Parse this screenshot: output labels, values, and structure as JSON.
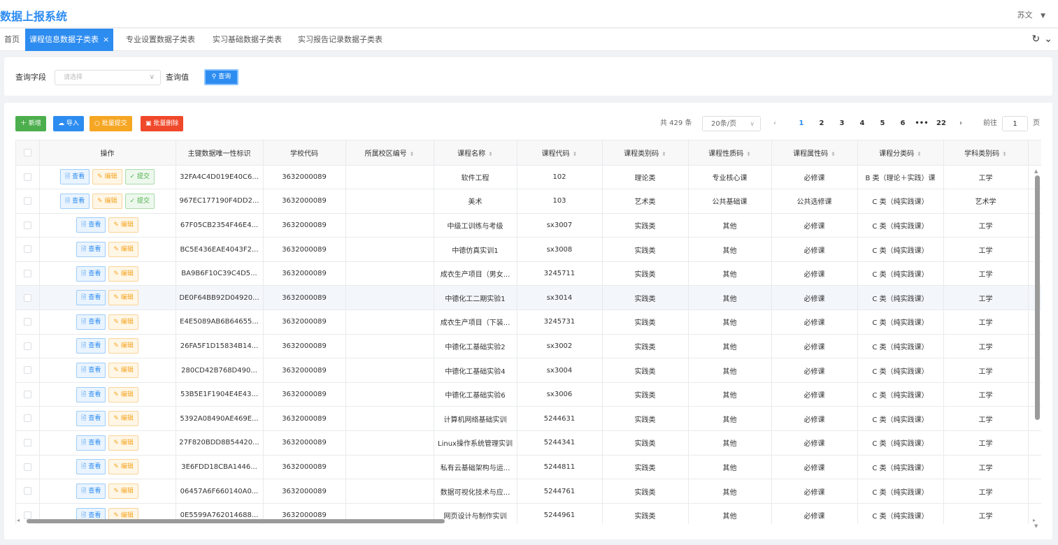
{
  "app": {
    "title": "数据上报系统",
    "user": "苏文"
  },
  "tabs": [
    {
      "label": "首页"
    },
    {
      "label": "课程信息数据子类表",
      "close": "×"
    },
    {
      "label": "专业设置数据子类表"
    },
    {
      "label": "实习基础数据子类表"
    },
    {
      "label": "实习报告记录数据子类表"
    }
  ],
  "query": {
    "field_label": "查询字段",
    "field_placeholder": "请选择",
    "value_label": "查询值",
    "search_button": "查询"
  },
  "toolbar": {
    "add": "新增",
    "import": "导入",
    "batch_submit": "批量提交",
    "batch_delete": "批量删除"
  },
  "pager": {
    "total": "共 429 条",
    "page_size": "20条/页",
    "pages": [
      "1",
      "2",
      "3",
      "4",
      "5",
      "6",
      "•••",
      "22"
    ],
    "current": "1",
    "goto_label": "前往",
    "goto_value": "1",
    "goto_suffix": "页"
  },
  "table": {
    "headers": [
      "操作",
      "主键数据唯一性标识",
      "学校代码",
      "所属校区编号",
      "课程名称",
      "课程代码",
      "课程类别码",
      "课程性质码",
      "课程属性码",
      "课程分类码",
      "学科类别码"
    ],
    "action_labels": {
      "view": "查看",
      "edit": "编辑",
      "submit": "提交"
    },
    "rows": [
      {
        "id": "32FA4C4D019E40C6...",
        "school": "3632000089",
        "campus": "",
        "name": "软件工程",
        "code": "102",
        "category": "理论类",
        "nature": "专业核心课",
        "attr": "必修课",
        "cls": "B 类（理论＋实践）课",
        "subject": "工学",
        "submit": true
      },
      {
        "id": "967EC177190F4DD2...",
        "school": "3632000089",
        "campus": "",
        "name": "美术",
        "code": "103",
        "category": "艺术类",
        "nature": "公共基础课",
        "attr": "公共选修课",
        "cls": "C 类（纯实践课）",
        "subject": "艺术学",
        "submit": true
      },
      {
        "id": "67F05CB2354F46E4...",
        "school": "3632000089",
        "campus": "",
        "name": "中级工训练与考级",
        "code": "sx3007",
        "category": "实践类",
        "nature": "其他",
        "attr": "必修课",
        "cls": "C 类（纯实践课）",
        "subject": "工学",
        "submit": false
      },
      {
        "id": "BC5E436EAE4043F2...",
        "school": "3632000089",
        "campus": "",
        "name": "中德仿真实训1",
        "code": "sx3008",
        "category": "实践类",
        "nature": "其他",
        "attr": "必修课",
        "cls": "C 类（纯实践课）",
        "subject": "工学",
        "submit": false
      },
      {
        "id": "BA9B6F10C39C4D5...",
        "school": "3632000089",
        "campus": "",
        "name": "成衣生产项目（男女...",
        "code": "3245711",
        "category": "实践类",
        "nature": "其他",
        "attr": "必修课",
        "cls": "C 类（纯实践课）",
        "subject": "工学",
        "submit": false
      },
      {
        "id": "DE0F64BB92D04920...",
        "school": "3632000089",
        "campus": "",
        "name": "中德化工二期实验1",
        "code": "sx3014",
        "category": "实践类",
        "nature": "其他",
        "attr": "必修课",
        "cls": "C 类（纯实践课）",
        "subject": "工学",
        "submit": false
      },
      {
        "id": "E4E5089AB6B64655...",
        "school": "3632000089",
        "campus": "",
        "name": "成衣生产项目（下装...",
        "code": "3245731",
        "category": "实践类",
        "nature": "其他",
        "attr": "必修课",
        "cls": "C 类（纯实践课）",
        "subject": "工学",
        "submit": false
      },
      {
        "id": "26FA5F1D15834B14...",
        "school": "3632000089",
        "campus": "",
        "name": "中德化工基础实验2",
        "code": "sx3002",
        "category": "实践类",
        "nature": "其他",
        "attr": "必修课",
        "cls": "C 类（纯实践课）",
        "subject": "工学",
        "submit": false
      },
      {
        "id": "280CD42B768D490...",
        "school": "3632000089",
        "campus": "",
        "name": "中德化工基础实验4",
        "code": "sx3004",
        "category": "实践类",
        "nature": "其他",
        "attr": "必修课",
        "cls": "C 类（纯实践课）",
        "subject": "工学",
        "submit": false
      },
      {
        "id": "53B5E1F1904E4E43...",
        "school": "3632000089",
        "campus": "",
        "name": "中德化工基础实验6",
        "code": "sx3006",
        "category": "实践类",
        "nature": "其他",
        "attr": "必修课",
        "cls": "C 类（纯实践课）",
        "subject": "工学",
        "submit": false
      },
      {
        "id": "5392A08490AE469E...",
        "school": "3632000089",
        "campus": "",
        "name": "计算机网络基础实训",
        "code": "5244631",
        "category": "实践类",
        "nature": "其他",
        "attr": "必修课",
        "cls": "C 类（纯实践课）",
        "subject": "工学",
        "submit": false
      },
      {
        "id": "27F820BDD8B54420...",
        "school": "3632000089",
        "campus": "",
        "name": "Linux操作系统管理实训",
        "code": "5244341",
        "category": "实践类",
        "nature": "其他",
        "attr": "必修课",
        "cls": "C 类（纯实践课）",
        "subject": "工学",
        "submit": false
      },
      {
        "id": "3E6FDD18CBA1446...",
        "school": "3632000089",
        "campus": "",
        "name": "私有云基础架构与运...",
        "code": "5244811",
        "category": "实践类",
        "nature": "其他",
        "attr": "必修课",
        "cls": "C 类（纯实践课）",
        "subject": "工学",
        "submit": false
      },
      {
        "id": "06457A6F660140A0...",
        "school": "3632000089",
        "campus": "",
        "name": "数据可视化技术与应...",
        "code": "5244761",
        "category": "实践类",
        "nature": "其他",
        "attr": "必修课",
        "cls": "C 类（纯实践课）",
        "subject": "工学",
        "submit": false
      },
      {
        "id": "0E5599A762014688...",
        "school": "3632000089",
        "campus": "",
        "name": "网页设计与制作实训",
        "code": "5244961",
        "category": "实践类",
        "nature": "其他",
        "attr": "必修课",
        "cls": "C 类（纯实践课）",
        "subject": "工学",
        "submit": false
      }
    ]
  }
}
